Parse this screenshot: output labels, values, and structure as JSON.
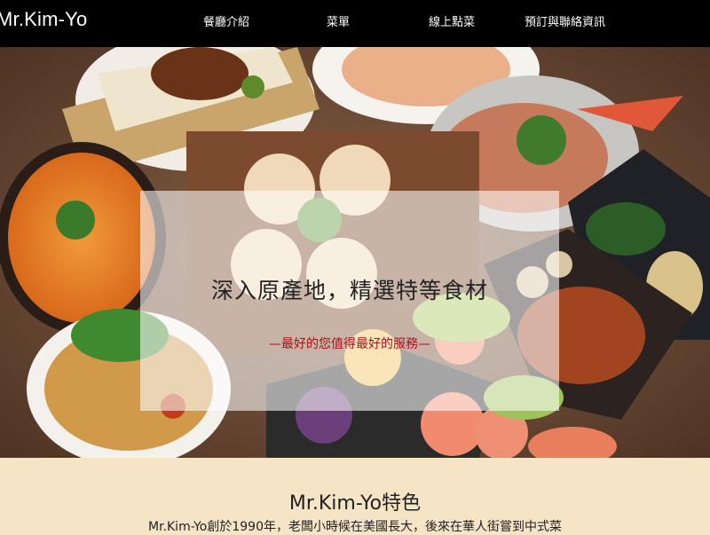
{
  "header": {
    "logo": "Mr.Kim-Yo",
    "nav": [
      "餐廳介紹",
      "菜單",
      "線上點菜",
      "預訂與聯絡資訊"
    ]
  },
  "hero": {
    "headline": "深入原產地，精選特等食材",
    "subline": "—最好的您值得最好的服務—"
  },
  "features": {
    "title": "Mr.Kim-Yo特色",
    "text": "Mr.Kim-Yo創於1990年，老闆小時候在美國長大，後來在華人街嘗到中式菜"
  },
  "colors": {
    "header_bg": "#000000",
    "accent_red": "#a8121c",
    "features_bg": "#f6e4c6"
  }
}
